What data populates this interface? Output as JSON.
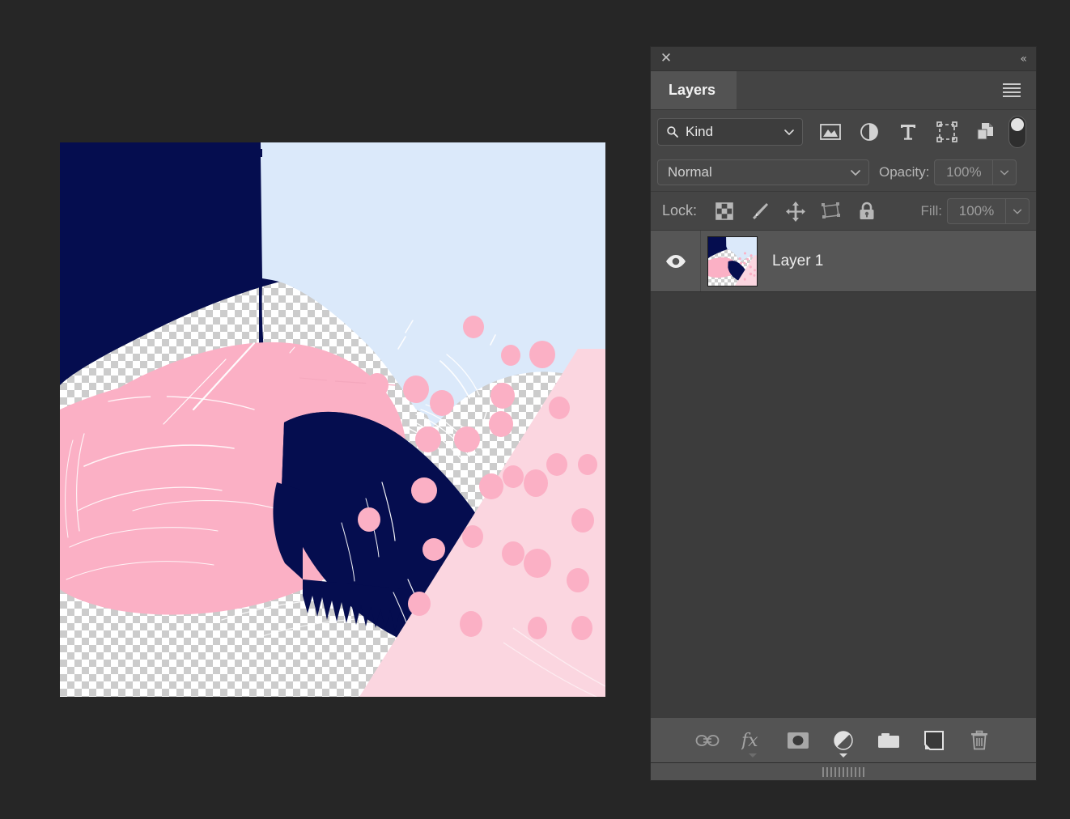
{
  "window": {
    "background_color": "#262626",
    "close_icon": "✕",
    "collapse_icon": "«"
  },
  "panel": {
    "title": "Layers",
    "menu_icon": "hamburger-icon",
    "accent_color": "#535353",
    "background_color": "#454545"
  },
  "filter": {
    "search_icon": "search-icon",
    "kind_label": "Kind",
    "chevron": "⌄",
    "icons": [
      {
        "name": "filter-pixel-layers-icon",
        "title": "Pixel layers"
      },
      {
        "name": "filter-adjustment-layers-icon",
        "title": "Adjustment layers"
      },
      {
        "name": "filter-type-layers-icon",
        "title": "Type layers"
      },
      {
        "name": "filter-shape-layers-icon",
        "title": "Shape layers"
      },
      {
        "name": "filter-smart-object-icon",
        "title": "Smart objects"
      }
    ],
    "toggle_state": "on"
  },
  "blend": {
    "mode": "Normal",
    "opacity_label": "Opacity:",
    "opacity_value": "100%",
    "chevron": "⌄"
  },
  "lock": {
    "label": "Lock:",
    "fill_label": "Fill:",
    "fill_value": "100%",
    "chevron": "⌄",
    "icons": [
      {
        "name": "lock-transparent-pixels-icon",
        "title": "Lock transparent pixels"
      },
      {
        "name": "lock-image-pixels-icon",
        "title": "Lock image pixels"
      },
      {
        "name": "lock-position-icon",
        "title": "Lock position"
      },
      {
        "name": "lock-artboard-nesting-icon",
        "title": "Prevent auto-nesting"
      },
      {
        "name": "lock-all-icon",
        "title": "Lock all"
      }
    ]
  },
  "layers": [
    {
      "name": "Layer 1",
      "visible": true,
      "selected": true,
      "eye_icon": "eye-icon"
    }
  ],
  "bottom_toolbar": [
    {
      "name": "link-layers-button",
      "icon": "link-icon",
      "label": "Link layers",
      "caret": false
    },
    {
      "name": "layer-style-button",
      "icon": "fx-icon",
      "label": "fx",
      "caret": true,
      "caret_dim": true
    },
    {
      "name": "add-layer-mask-button",
      "icon": "mask-icon",
      "label": "Add layer mask",
      "caret": false
    },
    {
      "name": "new-adjustment-layer-button",
      "icon": "adjustment-icon",
      "label": "New fill or adjustment layer",
      "caret": true,
      "caret_dim": false
    },
    {
      "name": "new-group-button",
      "icon": "folder-icon",
      "label": "New group",
      "caret": false
    },
    {
      "name": "new-layer-button",
      "icon": "new-layer-icon",
      "label": "Create new layer",
      "caret": false
    },
    {
      "name": "delete-layer-button",
      "icon": "trash-icon",
      "label": "Delete layer",
      "caret": false
    }
  ],
  "artwork": {
    "title": "Layer 1 artwork",
    "colors": {
      "navy": "#050d4f",
      "pink": "#fbb0c5",
      "light_pink": "#fbd6e0",
      "pale_blue": "#dbe9fa",
      "checker_light": "#ffffff",
      "checker_dark": "#cccccc"
    },
    "checker_size_px": 9
  }
}
